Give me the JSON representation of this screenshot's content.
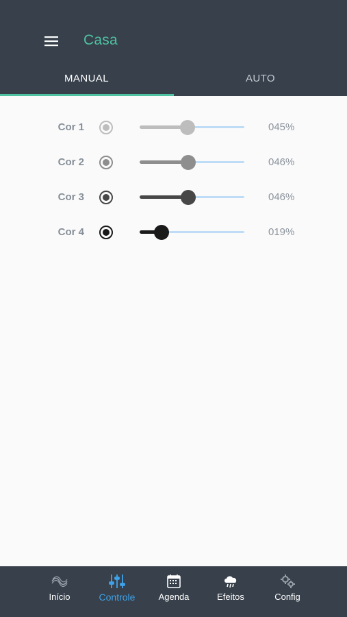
{
  "header": {
    "title": "Casa",
    "tabs": [
      {
        "label": "MANUAL",
        "active": true
      },
      {
        "label": "AUTO",
        "active": false
      }
    ],
    "accent_color": "#4fc3a1"
  },
  "colors": [
    {
      "label": "Cor 1",
      "value": 45,
      "value_text": "045%",
      "color": "#bdbdbd"
    },
    {
      "label": "Cor 2",
      "value": 46,
      "value_text": "046%",
      "color": "#8e8e8e"
    },
    {
      "label": "Cor 3",
      "value": 46,
      "value_text": "046%",
      "color": "#474747"
    },
    {
      "label": "Cor 4",
      "value": 19,
      "value_text": "019%",
      "color": "#1a1a1a"
    }
  ],
  "bottom_nav": [
    {
      "label": "Início",
      "icon": "wave-icon",
      "active": false
    },
    {
      "label": "Controle",
      "icon": "sliders-icon",
      "active": true
    },
    {
      "label": "Agenda",
      "icon": "calendar-icon",
      "active": false
    },
    {
      "label": "Efeitos",
      "icon": "cloud-rain-icon",
      "active": false
    },
    {
      "label": "Config",
      "icon": "gears-icon",
      "active": false
    }
  ],
  "active_nav_color": "#3fa3ea"
}
